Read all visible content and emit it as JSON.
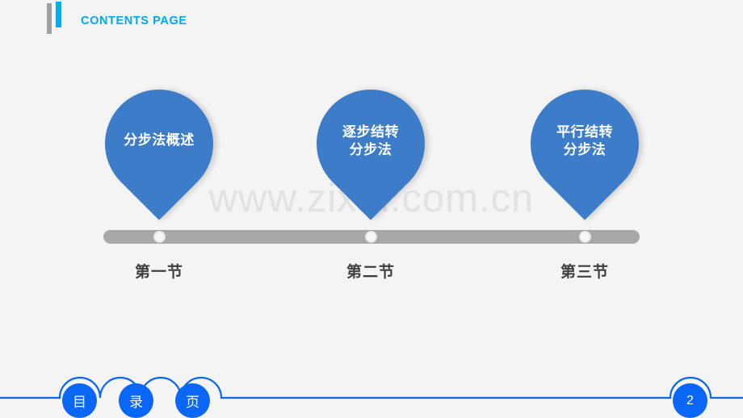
{
  "header": {
    "title": "CONTENTS PAGE",
    "accent_color": "#00a8ec",
    "bar_gray_color": "#a0a0a0"
  },
  "watermark": {
    "text": "www.zixin.com.cn",
    "color": "#e2e2e2"
  },
  "timeline": {
    "track_color": "#a8a8a8",
    "pin_color": "#3d7cc9",
    "items": [
      {
        "pin_text": "分步法概述",
        "section_label": "第一节",
        "lines": 1
      },
      {
        "pin_text": "逐步结转\n分步法",
        "section_label": "第二节",
        "lines": 2
      },
      {
        "pin_text": "平行结转\n分步法",
        "section_label": "第三节",
        "lines": 2
      }
    ]
  },
  "footer": {
    "line_color": "#0a66f5",
    "circle_color": "#0a66f5",
    "nav_items": [
      {
        "label": "目"
      },
      {
        "label": "录"
      },
      {
        "label": "页"
      }
    ],
    "page_number": "2"
  }
}
